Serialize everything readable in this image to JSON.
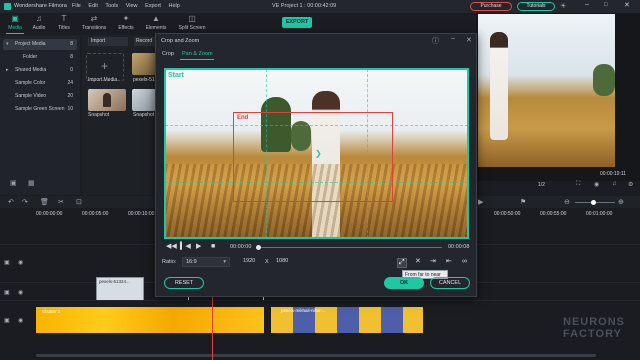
{
  "app": {
    "name": "Wondershare Filmora",
    "project": "VE Project 1 : 00:00:42:09",
    "menu": [
      "File",
      "Edit",
      "Tools",
      "View",
      "Export",
      "Help"
    ],
    "purchase": "Purchase",
    "tutorials": "Tutorials"
  },
  "toolbar": {
    "tabs": [
      "Media",
      "Audio",
      "Titles",
      "Transitions",
      "Effects",
      "Elements",
      "Split Screen"
    ],
    "export": "EXPORT"
  },
  "sidebar": {
    "items": [
      {
        "label": "Project Media",
        "count": "8"
      },
      {
        "label": "Folder",
        "count": "8"
      },
      {
        "label": "Shared Media",
        "count": "0"
      },
      {
        "label": "Sample Color",
        "count": "24"
      },
      {
        "label": "Sample Video",
        "count": "20"
      },
      {
        "label": "Sample Green Screen",
        "count": "10"
      }
    ]
  },
  "media": {
    "import_dropdown": "Import",
    "record_dropdown": "Record",
    "import_media": "Import Media",
    "clip1_name": "pexels-51",
    "clip2_name": "Snapshot",
    "clip3_name": "Snapshot"
  },
  "preview": {
    "time": "00:00:19:11",
    "zoom": "1/2"
  },
  "timeline": {
    "ruler": [
      "00:00:00:00",
      "00:00:05:00",
      "00:00:10:00",
      "00:00:50:00",
      "00:00:55:00",
      "00:01:00:00"
    ],
    "clip_text": "pexels-51324...",
    "clip_yellow": "Shutter 1",
    "clip_girl": "pexels-mikhail-nilov-..."
  },
  "dialog": {
    "title": "Crop and Zoom",
    "tabs": [
      "Crop",
      "Pan & Zoom"
    ],
    "start_label": "Start",
    "end_label": "End",
    "time_start": "00:00:00",
    "time_end": "00:00:08",
    "ratio_label": "Ratio:",
    "ratio_value": "16:9",
    "width": "1920",
    "x_sep": "X",
    "height": "1080",
    "tooltip": "From far to near",
    "reset": "RESET",
    "ok": "OK",
    "cancel": "CANCEL"
  },
  "watermark": {
    "line1": "NEURONS",
    "line2": "FACTORY"
  }
}
